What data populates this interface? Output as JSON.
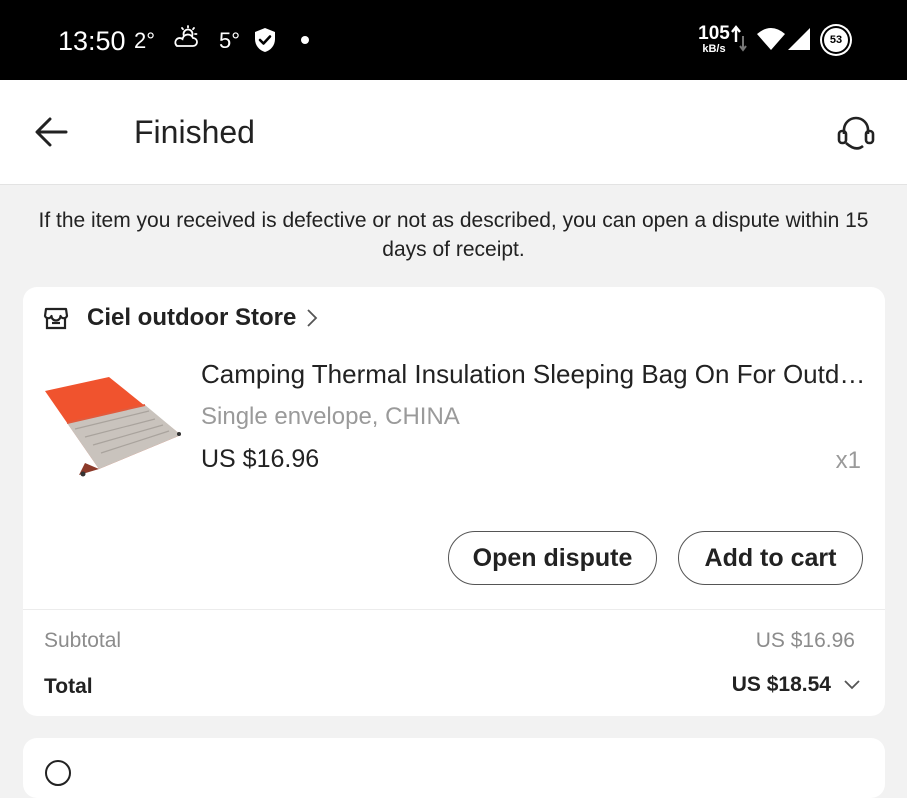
{
  "status_bar": {
    "time": "13:50",
    "temp_current": "2°",
    "weather_icon": "partly-cloudy-icon",
    "temp_forecast": "5°",
    "network_speed_value": "105",
    "network_speed_unit": "kB/s",
    "battery_level": "53"
  },
  "header": {
    "title": "Finished",
    "back_icon": "arrow-left-icon",
    "support_icon": "headset-icon"
  },
  "notice": "If the item you received is defective or not as described, you can open a dispute within 15 days of receipt.",
  "order": {
    "store_name": "Ciel outdoor Store",
    "product": {
      "title": "Camping Thermal Insulation Sleeping Bag On For Outdo...",
      "variant": "Single envelope, CHINA",
      "price": "US $16.96",
      "quantity": "x1",
      "image_colors": {
        "bag": "#f0532e",
        "lining": "#c9c3bd"
      }
    },
    "buttons": {
      "open_dispute": "Open dispute",
      "add_to_cart": "Add to cart"
    },
    "summary": {
      "subtotal_label": "Subtotal",
      "subtotal_value": "US $16.96",
      "total_label": "Total",
      "total_value": "US $18.54"
    }
  },
  "colors": {
    "background": "#f2f2f2",
    "card": "#ffffff",
    "text_primary": "#222222",
    "text_secondary": "#9a9a9a"
  }
}
